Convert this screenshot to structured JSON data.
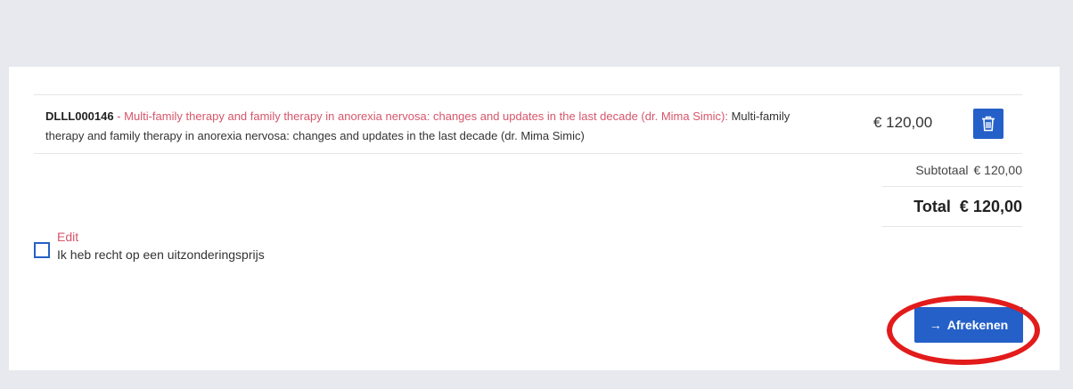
{
  "cart": {
    "item": {
      "code": "DLLL000146",
      "separator": " - ",
      "link_text": "Multi-family therapy and family therapy in anorexia nervosa: changes and updates in the last decade (dr. Mima Simic)",
      "colon": ":",
      "description": " Multi-family therapy and family therapy in anorexia nervosa: changes and updates in the last decade (dr. Mima Simic)",
      "price": "€ 120,00",
      "delete_icon": "trash-icon"
    },
    "subtotal": {
      "label": "Subtotaal",
      "value": "€ 120,00"
    },
    "total": {
      "label": "Total",
      "value": "€ 120,00"
    },
    "exception": {
      "edit_label": "Edit",
      "checkbox_label": "Ik heb recht op een uitzonderingsprijs",
      "checked": false
    },
    "checkout": {
      "arrow_icon": "arrow-right-icon",
      "arrow": "→",
      "label": "Afrekenen"
    }
  },
  "colors": {
    "primary": "#2460c8",
    "link": "#d6566b",
    "highlight": "#e21b1b",
    "page_background": "#e8e9ee",
    "card_background": "#ffffff"
  }
}
